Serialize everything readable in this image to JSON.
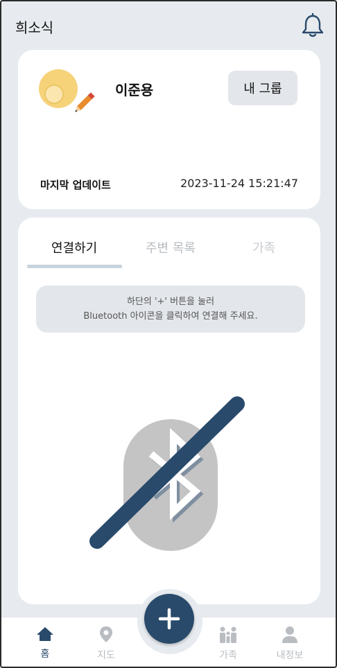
{
  "header": {
    "title": "희소식",
    "bell_icon": "bell-icon"
  },
  "profile": {
    "name": "이준용",
    "group_button": "내 그룹",
    "last_update_label": "마지막 업데이트",
    "last_update_time": "2023-11-24 15:21:47",
    "avatar_icon": "avatar-with-pencil-icon"
  },
  "tabs": {
    "items": [
      {
        "label": "연결하기",
        "active": true
      },
      {
        "label": "주변 목록",
        "active": false
      },
      {
        "label": "가족",
        "active": false
      }
    ]
  },
  "info": {
    "line1": "하단의 '+' 버튼을 눌러",
    "line2": "Bluetooth 아이콘을 클릭하여 연결해 주세요."
  },
  "bluetooth": {
    "icon": "bluetooth-disabled-icon"
  },
  "fab": {
    "icon": "plus-icon"
  },
  "bottom_nav": {
    "items": [
      {
        "label": "홈",
        "icon": "home-icon",
        "active": true
      },
      {
        "label": "지도",
        "icon": "map-pin-icon",
        "active": false
      },
      {
        "label": "가족",
        "icon": "family-icon",
        "active": false
      },
      {
        "label": "내정보",
        "icon": "person-icon",
        "active": false
      }
    ]
  },
  "colors": {
    "primary": "#294a6b",
    "background": "#e7ebef",
    "inactive": "#b9bdc2"
  }
}
